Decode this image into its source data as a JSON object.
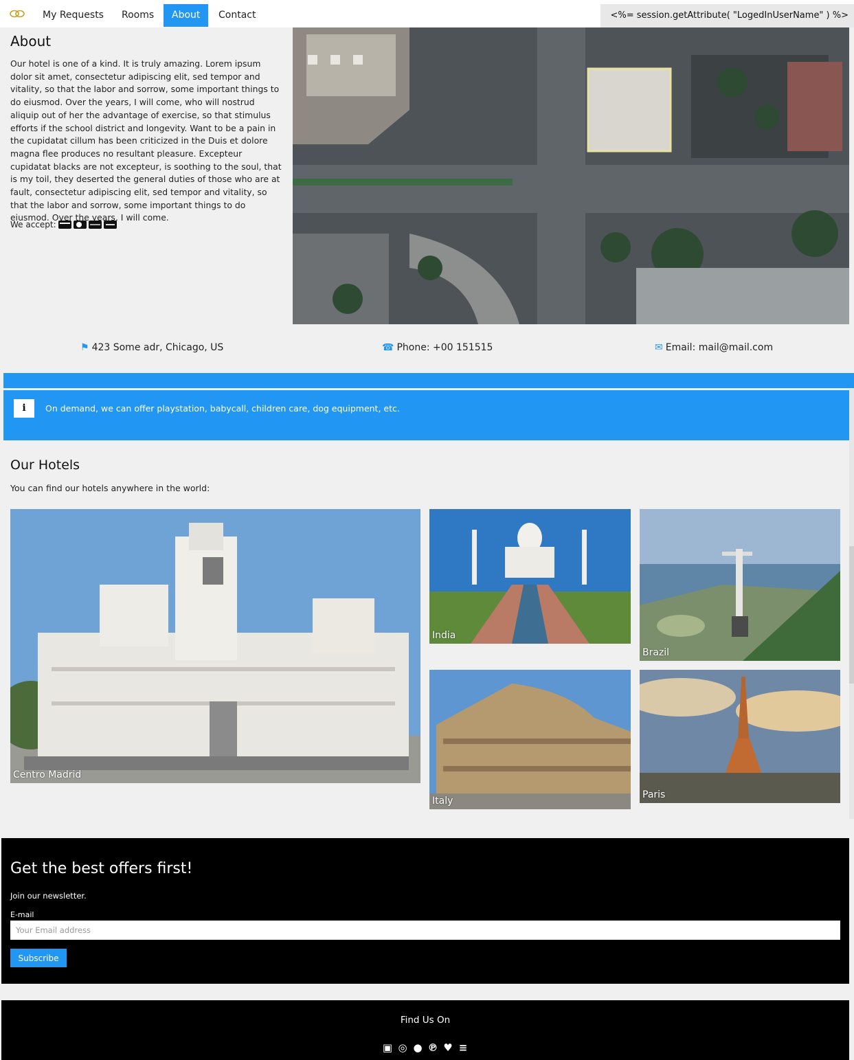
{
  "nav": {
    "items": [
      {
        "label": "My Requests"
      },
      {
        "label": "Rooms"
      },
      {
        "label": "About"
      },
      {
        "label": "Contact"
      }
    ],
    "active": "About",
    "user_label": "<%= session.getAttribute( \"LogedInUserName\" ) %>"
  },
  "about": {
    "title": "About",
    "text": "Our hotel is one of a kind. It is truly amazing. Lorem ipsum dolor sit amet, consectetur adipiscing elit, sed tempor and vitality, so that the labor and sorrow, some important things to do eiusmod. Over the years, I will come, who will nostrud aliquip out of her the advantage of exercise, so that stimulus efforts if the school district and longevity. Want to be a pain in the cupidatat cillum has been criticized in the Duis et dolore magna flee produces no resultant pleasure. Excepteur cupidatat blacks are not excepteur, is soothing to the soul, that is my toil, they deserted the general duties of those who are at fault, consectetur adipiscing elit, sed tempor and vitality, so that the labor and sorrow, some important things to do eiusmod. Over the years, I will come.",
    "accept_label": "We accept:"
  },
  "contact": {
    "address": "423 Some adr, Chicago, US",
    "phone": "Phone: +00 151515",
    "email": "Email: mail@mail.com"
  },
  "info": {
    "icon_text": "i",
    "text": "On demand, we can offer playstation, babycall, children care, dog equipment, etc."
  },
  "hotels": {
    "title": "Our Hotels",
    "subtitle": "You can find our hotels anywhere in the world:",
    "items": [
      {
        "caption": "Centro Madrid"
      },
      {
        "caption": "India"
      },
      {
        "caption": "Brazil"
      },
      {
        "caption": "Italy"
      },
      {
        "caption": "Paris"
      }
    ]
  },
  "newsletter": {
    "title": "Get the best offers first!",
    "subtitle": "Join our newsletter.",
    "email_label": "E-mail",
    "email_placeholder": "Your Email address",
    "subscribe_label": "Subscribe"
  },
  "footer": {
    "title": "Find Us On"
  },
  "colors": {
    "accent": "#2196F3",
    "dark": "#000000",
    "page_bg": "#f0f0f0"
  }
}
